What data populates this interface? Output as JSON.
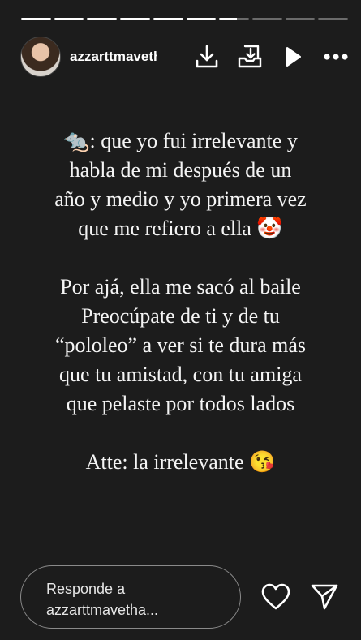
{
  "story": {
    "username": "azzarttmavethalia",
    "segments": [
      1,
      1,
      1,
      1,
      1,
      1,
      0.6,
      0,
      0,
      0
    ],
    "lines_block1": [
      "🐀: que yo fui irrelevante y",
      "habla de mi después de un",
      "año y medio y yo primera vez",
      "que me refiero a ella 🤡"
    ],
    "lines_block2": [
      "Por ajá, ella me sacó al baile",
      "Preocúpate de ti y de tu",
      "“pololeo” a ver si te dura más",
      "que tu amistad, con tu amiga",
      "que pelaste por todos lados"
    ],
    "signoff": "Atte: la irrelevante 😘"
  },
  "header_icons": [
    "download-icon",
    "save-icon",
    "play-icon",
    "more-icon"
  ],
  "footer": {
    "reply_line1": "Responde a",
    "reply_line2": "azzarttmavetha..."
  },
  "footer_icons": [
    "heart-icon",
    "send-icon"
  ]
}
